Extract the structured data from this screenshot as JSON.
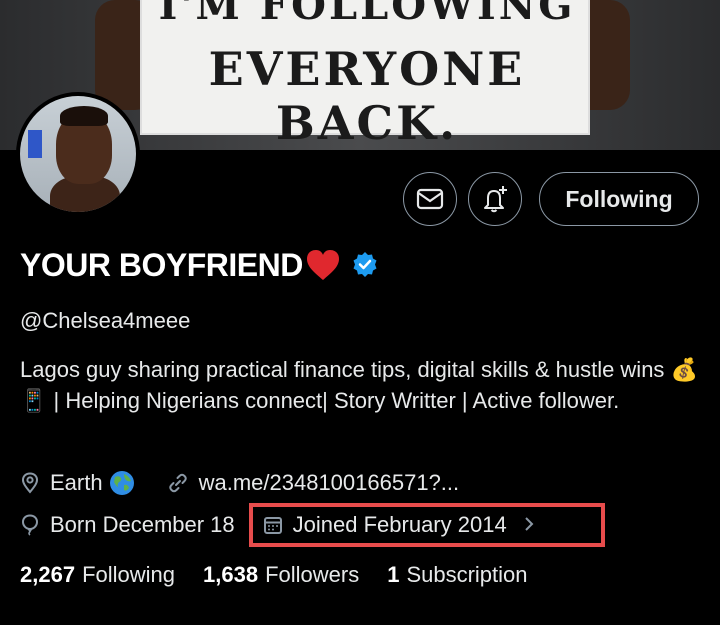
{
  "banner": {
    "sign_line1": "I'M FOLLOWING",
    "sign_line2": "EVERYONE BACK."
  },
  "profile": {
    "display_name": "YOUR BOYFRIEND",
    "handle": "@Chelsea4meee",
    "verified": true,
    "bio": "Lagos guy sharing practical finance tips, digital skills & hustle wins 💰📱 | Helping Nigerians connect| Story Writter | Active follower.",
    "location": "Earth",
    "link": "wa.me/2348100166571?...",
    "birthday": "Born December 18",
    "joined": "Joined February 2014"
  },
  "actions": {
    "following_label": "Following"
  },
  "stats": {
    "following_count": "2,267",
    "following_label": "Following",
    "followers_count": "1,638",
    "followers_label": "Followers",
    "subscription_count": "1",
    "subscription_label": "Subscription"
  },
  "icons": {
    "message": "envelope-icon",
    "notify": "bell-plus-icon",
    "location": "map-pin-icon",
    "link": "link-icon",
    "birthday": "balloon-icon",
    "joined": "calendar-icon"
  },
  "colors": {
    "background": "#000000",
    "text": "#e7e9ea",
    "muted": "#8b98a5",
    "verified": "#1d9bf0",
    "highlight": "#e74c4c"
  }
}
